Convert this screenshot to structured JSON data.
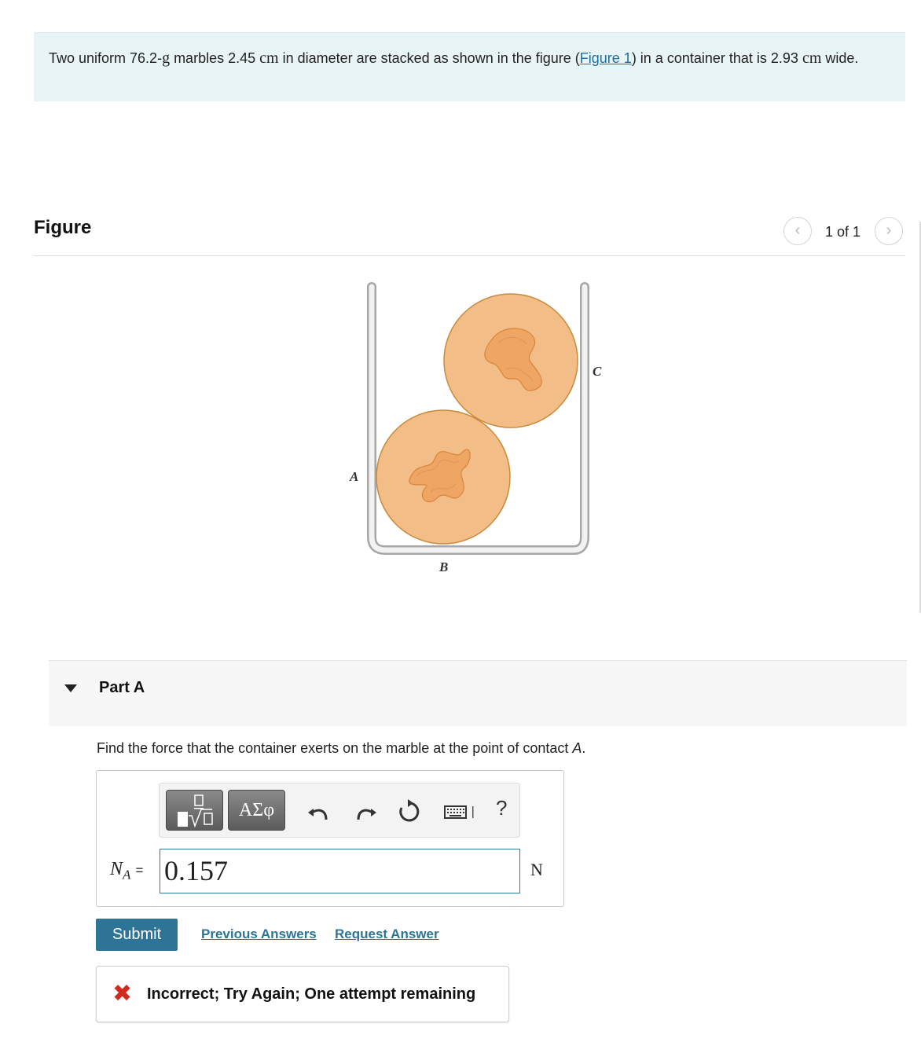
{
  "problem": {
    "text_part1": "Two uniform 76.2-",
    "mass_unit": "g",
    "text_part2": " marbles 2.45 ",
    "diameter_unit": "cm",
    "text_part3": " in diameter are stacked as shown in the figure (",
    "figure_link": "Figure 1",
    "text_part4": ") in a container that is 2.93 ",
    "width_unit": "cm",
    "text_part5": " wide."
  },
  "figure": {
    "title": "Figure",
    "pager_text": "1 of 1",
    "point_labels": {
      "a": "A",
      "b": "B",
      "c": "C"
    },
    "marble_color": "#f3bd87",
    "marble_outline": "#c98a3a"
  },
  "part": {
    "label": "Part A",
    "question_text": "Find the force that the container exerts on the marble at the point of contact ",
    "question_point": "A",
    "question_end": "."
  },
  "answer": {
    "var_symbol": "N",
    "var_subscript": "A",
    "equals": "=",
    "value": "0.157",
    "unit": "N",
    "greek_label": "ΑΣφ",
    "help_label": "?"
  },
  "actions": {
    "submit_label": "Submit",
    "previous_answers": "Previous Answers",
    "request_answer": "Request Answer"
  },
  "feedback": {
    "icon": "✖",
    "message": "Incorrect; Try Again; One attempt remaining",
    "color": "#d12a1f"
  },
  "colors": {
    "accent": "#2e7497",
    "problem_bg": "#e9f4f7"
  }
}
